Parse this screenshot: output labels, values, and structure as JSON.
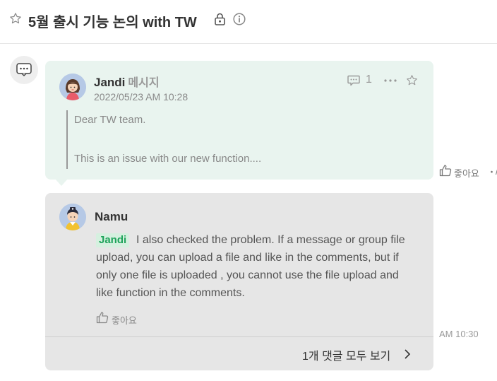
{
  "header": {
    "title": "5월 출시 기능 논의 with TW",
    "favorite_icon": "star-outline-icon",
    "lock_icon": "lock-icon",
    "info_icon": "info-icon"
  },
  "message": {
    "sender": "Jandi",
    "sender_suffix": "메시지",
    "timestamp": "2022/05/23 AM 10:28",
    "comment_count": "1",
    "body_line_1": "Dear TW team.",
    "body_line_2": "This is an issue with our new function....",
    "like_label": "좋아요",
    "side_separator": "・",
    "side_cut_text": "/"
  },
  "reply": {
    "sender": "Namu",
    "mention": "Jandi",
    "line_1": "I also checked the problem. If a message or group file",
    "line_2": "upload, you can upload a file and like in the comments, but if",
    "line_3": "only one file is uploaded , you cannot use the file upload and",
    "line_4": "like function in the comments.",
    "like_label": "좋아요",
    "time": "AM 10:30",
    "view_all_label": "1개 댓글 모두 보기"
  },
  "colors": {
    "message_card_bg": "#e9f4ef",
    "reply_card_bg": "#e6e6e6",
    "mention_text": "#1ea35a",
    "mention_bg": "#d5f0df"
  }
}
